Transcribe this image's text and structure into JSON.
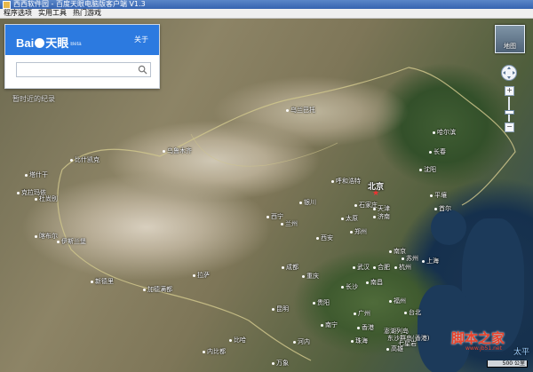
{
  "window": {
    "title": "西西软件园 - 百度天眼电脑版客户端    V1.3"
  },
  "menu": {
    "items": [
      "程序选项",
      "实用工具",
      "热门游戏"
    ]
  },
  "search": {
    "logo_text": "Bai",
    "logo_suffix": "天眼",
    "beta": "Beta",
    "about": "关于",
    "placeholder": "",
    "recent": "暂时近的纪录"
  },
  "map": {
    "capital": "北京",
    "cities": {
      "wulumuqi": "乌鲁木齐",
      "kelamayi": "克拉玛依",
      "bishikaike": "比什凯克",
      "tashigan": "塔什干",
      "dushanbe": "杜尚别",
      "kabul": "喀布尔",
      "islamabad": "伊斯兰堡",
      "newdelhi": "新德里",
      "jiademan": "加德满都",
      "lasa": "拉萨",
      "xining": "西宁",
      "lanzhou": "兰州",
      "yinchuan": "银川",
      "huhehaote": "呼和浩特",
      "shijiazhuang": "石家庄",
      "tianjin": "天津",
      "taiyuan": "太原",
      "jinan": "济南",
      "zhengzhou": "郑州",
      "xian": "西安",
      "chengdu": "成都",
      "chongqing": "重庆",
      "wuhan": "武汉",
      "hefei": "合肥",
      "nanjing": "南京",
      "hangzhou": "杭州",
      "changsha": "长沙",
      "nanchang": "南昌",
      "fuzhou": "福州",
      "guiyang": "贵阳",
      "kunming": "昆明",
      "nanning": "南宁",
      "guangzhou": "广州",
      "shenyang": "沈阳",
      "changchun": "长春",
      "haerbin": "哈尔滨",
      "pyongyang": "平壤",
      "seoul": "首尔",
      "wulanbatuo": "乌兰巴托",
      "shanghai": "上海",
      "suzhou": "苏州",
      "taibei": "台北",
      "gaoxiong": "高雄",
      "hongkong": "香港",
      "zhuhai": "珠海",
      "penghu": "澎湖列岛",
      "dongsha": "东沙群岛(香港)",
      "qiba": "七星岩",
      "bihua": "比哈",
      "hanoi": "河内",
      "wanxiang": "万象",
      "nepal": "内比都"
    },
    "zoom_level": 0.6,
    "scale": "500 公里",
    "minimap_label": "地图",
    "corner_text": "太平"
  },
  "watermark": {
    "main": "脚本之家",
    "sub": "www.jb51.net"
  }
}
